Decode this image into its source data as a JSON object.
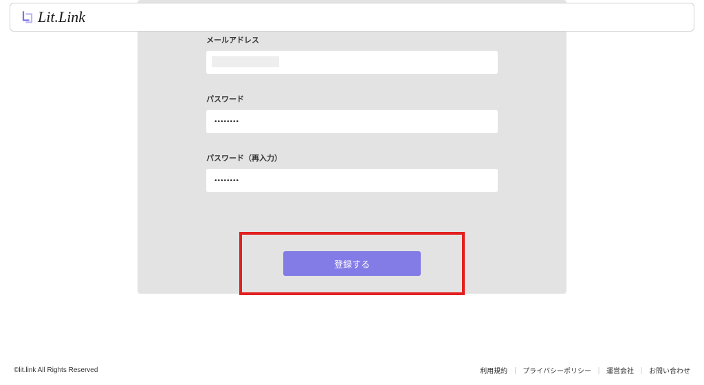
{
  "header": {
    "logo_text": "Lit.Link"
  },
  "form": {
    "email_label": "メールアドレス",
    "password_label": "パスワード",
    "password_value": "••••••••",
    "password_confirm_label": "パスワード（再入力）",
    "password_confirm_value": "••••••••",
    "submit_label": "登録する"
  },
  "footer": {
    "copyright": "©lit.link All Rights Reserved",
    "links": {
      "terms": "利用規約",
      "privacy": "プライバシーポリシー",
      "company": "運営会社",
      "contact": "お問い合わせ"
    },
    "separator": "｜"
  }
}
